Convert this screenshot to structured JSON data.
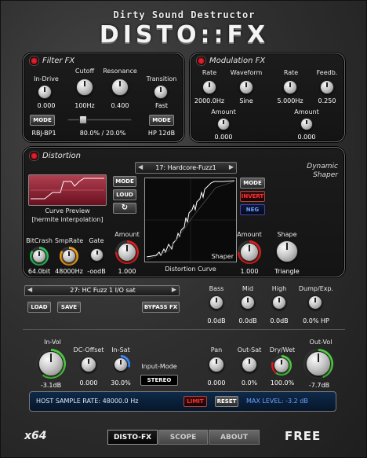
{
  "header": {
    "subtitle": "Dirty Sound Destructor",
    "logo": "DISTO::FX"
  },
  "filter": {
    "title": "Filter FX",
    "in_drive": {
      "label": "In-Drive",
      "value": "0.000"
    },
    "cutoff": {
      "label": "Cutoff",
      "value": "100Hz"
    },
    "resonance": {
      "label": "Resonance",
      "value": "0.400"
    },
    "transition": {
      "label": "Transition",
      "value": "Fast"
    },
    "mode_label": "MODE",
    "mode_left": "RBJ-BP1",
    "mix_value": "80.0% / 20.0%",
    "mode_right": "HP 12dB"
  },
  "modulation": {
    "title": "Modulation FX",
    "rate1": {
      "label": "Rate",
      "value": "2000.0Hz"
    },
    "waveform": {
      "label": "Waveform",
      "value": "Sine"
    },
    "rate2": {
      "label": "Rate",
      "value": "5.000Hz"
    },
    "feedb": {
      "label": "Feedb.",
      "value": "0.250"
    },
    "amount1": {
      "label": "Amount",
      "value": "0.000"
    },
    "amount2": {
      "label": "Amount",
      "value": "0.000"
    }
  },
  "distortion": {
    "title": "Distortion",
    "preset": "17: Hardcore-Fuzz1",
    "dynamic_label": "Dynamic",
    "shaper_label": "Shaper",
    "curve_preview_label": "Curve Preview",
    "interp_label": "[hermite interpolation]",
    "mode_label": "MODE",
    "loud_label": "LOUD",
    "refresh_symbol": "↻",
    "bitcrash": {
      "label": "BitCrash",
      "value": "64.0bit"
    },
    "smprate": {
      "label": "SmpRate",
      "value": "48000Hz"
    },
    "gate": {
      "label": "Gate",
      "value": "-oodB"
    },
    "amount": {
      "label": "Amount",
      "value": "1.000"
    },
    "curve_label": "Distortion Curve",
    "shaper_graph_label": "Shaper",
    "right_mode": "MODE",
    "invert": "INVERT",
    "neg": "NEG",
    "shaper_amount": {
      "label": "Amount",
      "value": "1.000"
    },
    "shape": {
      "label": "Shape",
      "value": "Triangle"
    }
  },
  "preset_bar": {
    "preset": "27: HC Fuzz 1 I/O sat",
    "load": "LOAD",
    "save": "SAVE",
    "bypass": "BYPASS FX"
  },
  "eq": {
    "bass": {
      "label": "Bass",
      "value": "0.0dB"
    },
    "mid": {
      "label": "Mid",
      "value": "0.0dB"
    },
    "high": {
      "label": "High",
      "value": "0.0dB"
    },
    "dump": {
      "label": "Dump/Exp.",
      "value": "0.0% HP"
    }
  },
  "io": {
    "in_vol": {
      "label": "In-Vol",
      "value": "-3.1dB"
    },
    "dc_offset": {
      "label": "DC-Offset",
      "value": "0.000"
    },
    "in_sat": {
      "label": "In-Sat",
      "value": "30.0%"
    },
    "input_mode_label": "Input-Mode",
    "input_mode": "STEREO",
    "pan": {
      "label": "Pan",
      "value": "0.000"
    },
    "out_sat": {
      "label": "Out-Sat",
      "value": "0.0%"
    },
    "dry_wet": {
      "label": "Dry/Wet",
      "value": "100.0%"
    },
    "out_vol": {
      "label": "Out-Vol",
      "value": "-7.7dB"
    }
  },
  "status": {
    "sample_rate": "HOST SAMPLE RATE: 48000.0 Hz",
    "limit": "LIMIT",
    "reset": "RESET",
    "max_level": "MAX LEVEL: -3.2 dB"
  },
  "footer": {
    "arch": "x64",
    "tabs": [
      "DISTO-FX",
      "SCOPE",
      "ABOUT"
    ],
    "edition": "FREE"
  },
  "colors": {
    "accent_red": "#e02020",
    "accent_orange": "#f0a020",
    "accent_green": "#50d040",
    "accent_blue": "#3a8cff"
  }
}
